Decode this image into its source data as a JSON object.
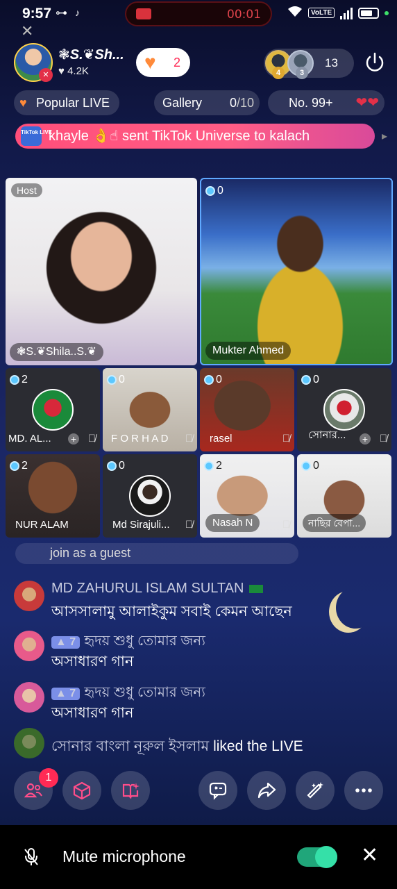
{
  "status_bar": {
    "time": "9:57",
    "record_timer": "00:01",
    "network_badge": "VoLTE"
  },
  "host": {
    "name": "❃S.❦Sh...",
    "likes": "4.2K",
    "follow_count": "2"
  },
  "viewers": {
    "rank1": "4",
    "rank2": "3",
    "count": "13"
  },
  "pills": {
    "popular": "Popular LIVE",
    "gallery_label": "Gallery",
    "gallery_count": "0",
    "gallery_total": "/10",
    "rank": "No. 99+"
  },
  "banner": {
    "logo": "TikTok LIVE",
    "text": "khayle 👌☝ sent TikTok Universe to kalach"
  },
  "tiles": {
    "host_tag": "Host",
    "host_name": "❃S.❦Shila..S.❦",
    "mukter_score": "0",
    "mukter_name": "Mukter Ahmed",
    "t1_score": "2",
    "t1_name": "MD. AL...",
    "t2_score": "0",
    "t2_name": "F O R H A D",
    "t3_score": "0",
    "t3_name": "rasel",
    "t4_score": "0",
    "t4_name": "সোনার...",
    "t5_score": "2",
    "t5_name": "NUR ALAM",
    "t6_score": "0",
    "t6_name": "Md Sirajuli...",
    "t7_score": "2",
    "t7_name": "Nasah N",
    "t8_score": "0",
    "t8_name": "নাছির বেপা..."
  },
  "join_text": "join as a guest",
  "chat": [
    {
      "name": "MD ZAHURUL ISLAM SULTAN",
      "message": "আসসালামু আলাইকুম সবাই কেমন আছেন"
    },
    {
      "level": "7",
      "name": "হৃদয় শুধু তোমার জন্য",
      "message": "অসাধারণ গান"
    },
    {
      "level": "7",
      "name": "হৃদয় শুধু তোমার জন্য",
      "message": "অসাধারণ গান"
    },
    {
      "name": "সোনার বাংলা নূরুল ইসলাম",
      "message": "liked the LIVE"
    }
  ],
  "toolbar": {
    "guests_badge": "1"
  },
  "sheet": {
    "label": "Mute microphone",
    "toggle_on": true
  },
  "colors": {
    "accent_pink": "#ff2a55",
    "toggle_green": "#35e0a8",
    "banner": "#ff4e7a"
  }
}
